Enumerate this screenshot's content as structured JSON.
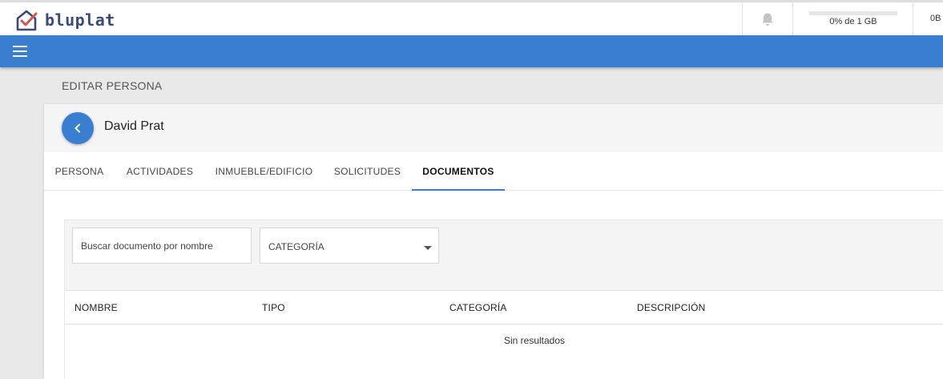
{
  "brand": {
    "name": "bluplat",
    "accent": "#3a7ed1"
  },
  "topbar": {
    "notifications_icon": "bell-icon",
    "storage": {
      "used_fraction": 0.0,
      "text": "0% de 1 GB"
    },
    "right_text": "0B"
  },
  "nav": {
    "menu_icon": "hamburger-icon"
  },
  "page": {
    "title": "EDITAR PERSONA"
  },
  "person": {
    "name": "David Prat",
    "back_icon": "chevron-left-icon"
  },
  "tabs": [
    {
      "label": "PERSONA",
      "active": false
    },
    {
      "label": "ACTIVIDADES",
      "active": false
    },
    {
      "label": "INMUEBLE/EDIFICIO",
      "active": false
    },
    {
      "label": "SOLICITUDES",
      "active": false
    },
    {
      "label": "DOCUMENTOS",
      "active": true
    }
  ],
  "documents": {
    "search": {
      "placeholder": "Buscar documento por nombre",
      "value": ""
    },
    "category_select": {
      "label": "CATEGORÍA",
      "icon": "caret-down-icon"
    },
    "table": {
      "columns": [
        "NOMBRE",
        "TIPO",
        "CATEGORÍA",
        "DESCRIPCIÓN"
      ],
      "rows": [],
      "empty_text": "Sin resultados"
    }
  }
}
